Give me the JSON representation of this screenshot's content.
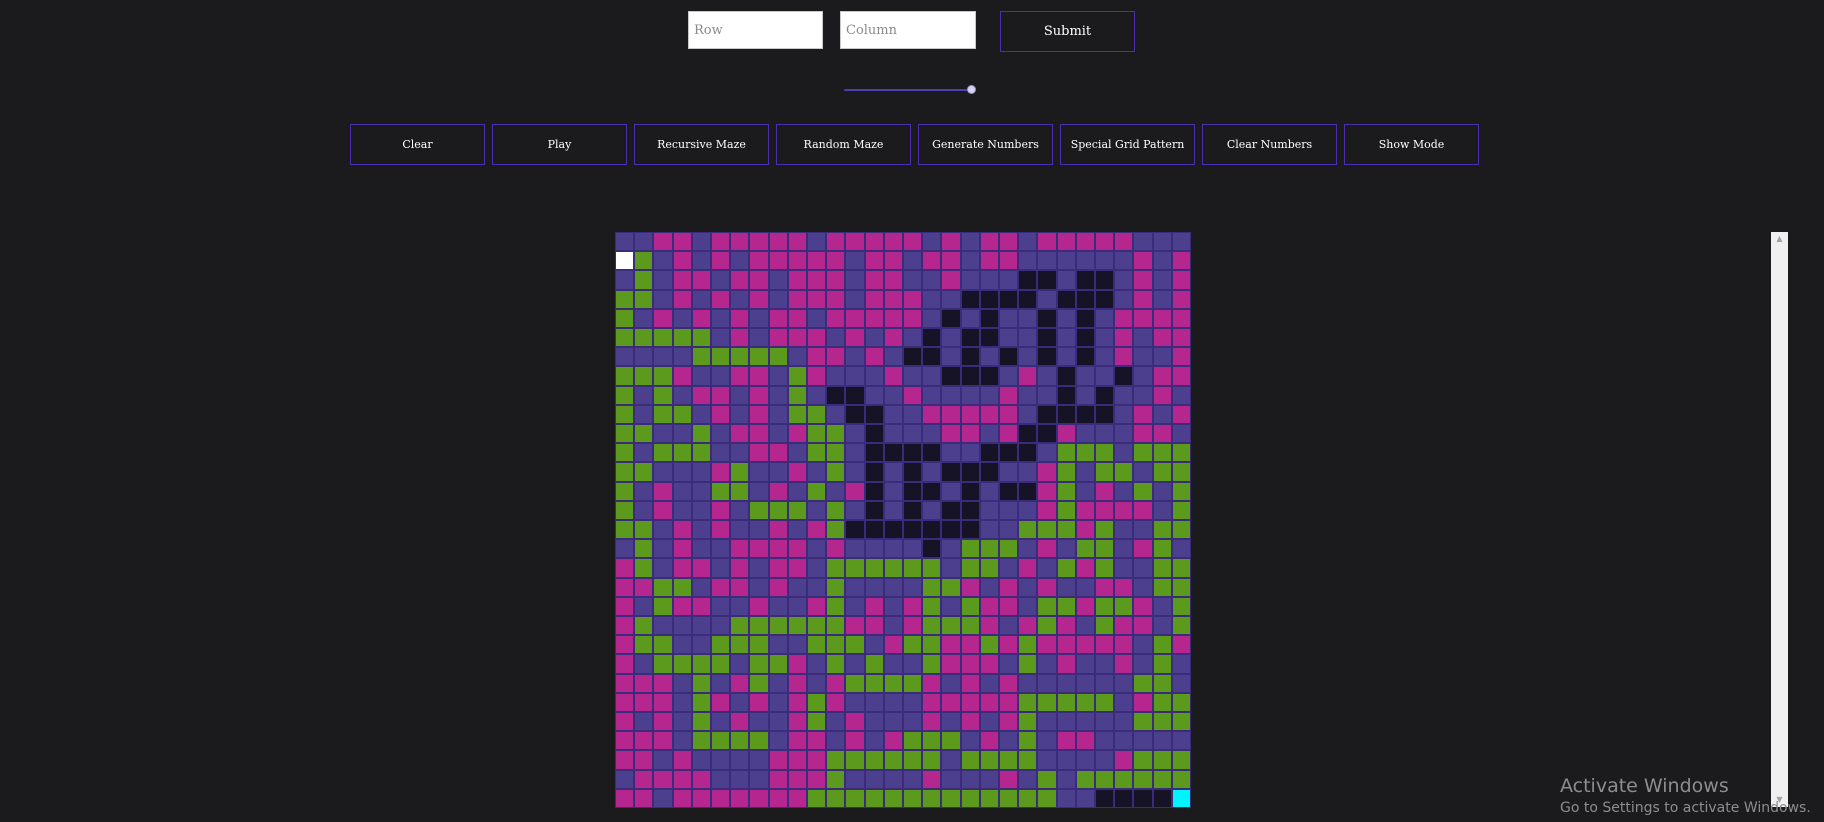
{
  "inputs": {
    "row_placeholder": "Row",
    "row_value": "",
    "column_placeholder": "Column",
    "column_value": ""
  },
  "submit_label": "Submit",
  "speed_slider": {
    "value": 1.0
  },
  "toolbar": {
    "buttons": [
      "Clear",
      "Play",
      "Recursive Maze",
      "Random Maze",
      "Generate Numbers",
      "Special Grid Pattern",
      "Clear Numbers",
      "Show Mode"
    ]
  },
  "grid": {
    "rows": 30,
    "cols": 30,
    "legend": {
      "P": "cell-empty",
      "M": "cell-magenta",
      "G": "cell-green",
      "K": "cell-wall",
      "S": "cell-start",
      "E": "cell-end"
    },
    "colors": {
      "P": "#4b3f8e",
      "M": "#b5268f",
      "G": "#5b9a1d",
      "K": "#171326",
      "S": "#ffffff",
      "E": "#00f4ff"
    },
    "cells": [
      "PPMMPMMMMMPMMMMMPMPMMPMMMMMPPP",
      "SGPMPMPMMMMMPMMPMMPMMPPPPPPMPM",
      "PGPMMPMMPMMMPMMPPMPPPKKPKKPMPM",
      "GGPMPMPMPMMMPMMMPPKKKKPKKKPMPM",
      "GPMPMPMPMMPMMMMMPKPKPPKPKPMMMM",
      "GGGGGPMPMMMPMPMPKPKKPPKPKPMPMM",
      "PPPPGGGGGPMMPMPKKPKPKPKPKPMPPM",
      "GGGMPPMMPGMPPPMPPKKKPMPKPPKPMM",
      "GPGPMMPMPGPKKPPMPPPPMPPKPKPPMP",
      "GPGGPMPMPGGPKKPPMMMMMPKKKKPMPM",
      "GGPPGPMMPMGGPKPPPMMPMKKMPPPMMP",
      "GPGGGPPMMPGGPKKKKPPKKKPGGGPGGGP",
      "GGPPPMGPPMPGPKPKPKKKPPMGPGGPGG",
      "GPMPPGGPMPGPMKPKKPKPKKMGPMPGPG",
      "GPMPPMPGGGPGPKPKPKKPPPMGMMMMPG",
      "GGPMPMPPMPMGKKKKKKKPPGGGMGPPGG",
      "PGPMPPMMMMPMPPPPKPGGGPMPGGPMGP",
      "MGPMMPMPMMPGGGGGGPGGPMPGMGPPGG",
      "MMGGPMMPMPPGPPPPGGMPMPMPPMMPGG",
      "MPGMMPPMPPMGPMPMGPGMMPGGMGGMPG",
      "MGPPPPGGGGGGMMPMGGGMPMGMPGMMPG",
      "MGGPPGGGPPGGGPMGGMMGMGMMMMMPGM",
      "MPGGGGPGGMPGPGPPGMMMPGPMPPMPGP",
      "MMMPGPMGPMPMGGGGMPMPMPPPPPPGG",
      "MMMPGMPMPMGMPPPPMMMMMGGGGGPMGG",
      "MPMPGPMPPMGPMPPPMPMPMGPPPPPGGG",
      "MMMPGGGGPMMPMPMGGGPMPGPMMPPPPP",
      "MMPMPPPPMMMGGGGGGPGGGGPPPPMGGG",
      "PMMMMPPPMMMGPPPPMPPPMPGPGGGGGG",
      "MMPMMMMMMMGGGGGGGGGGGGGPPKKKKE"
    ]
  },
  "watermark": {
    "title": "Activate Windows",
    "subtitle": "Go to Settings to activate Windows."
  }
}
